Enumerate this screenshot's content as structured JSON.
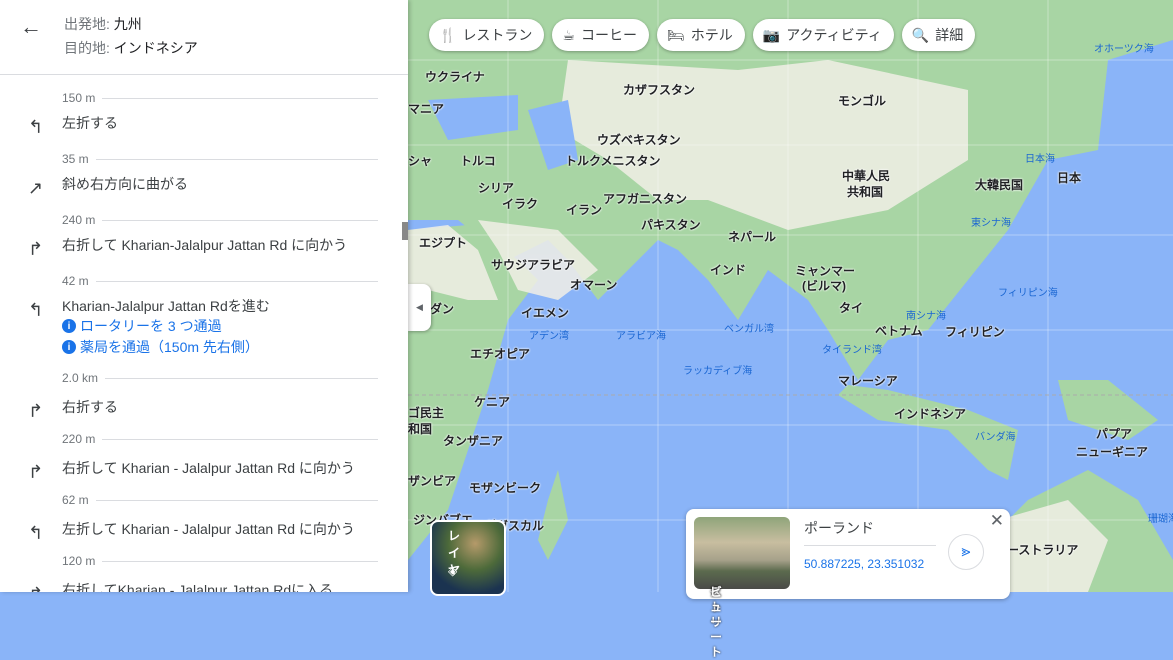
{
  "header": {
    "origin_label": "出発地: ",
    "origin": "九州",
    "dest_label": "目的地: ",
    "dest": "インドネシア"
  },
  "steps": [
    {
      "distance": "150 m",
      "instruction": "左折する",
      "icon": "turn-left-icon"
    },
    {
      "distance": "35 m",
      "instruction": "斜め右方向に曲がる",
      "icon": "slight-right-icon"
    },
    {
      "distance": "240 m",
      "instruction": "右折して Kharian-Jalalpur Jattan Rd に向かう",
      "icon": "turn-right-icon"
    },
    {
      "distance": "42 m",
      "instruction": "Kharian-Jalalpur Jattan Rdを進む",
      "icon": "turn-left-icon",
      "notes": [
        "ロータリーを 3 つ通過",
        "薬局を通過（150m 先右側）"
      ]
    },
    {
      "distance": "2.0 km",
      "instruction": "右折する",
      "icon": "turn-right-icon"
    },
    {
      "distance": "220 m",
      "instruction": "右折して Kharian - Jalalpur Jattan Rd に向かう",
      "icon": "turn-right-icon"
    },
    {
      "distance": "62 m",
      "instruction": "左折して Kharian - Jalalpur Jattan Rd に向かう",
      "icon": "turn-left-icon"
    },
    {
      "distance": "120 m",
      "instruction": "右折してKharian - Jalalpur Jattan Rdに入る",
      "icon": "turn-right-icon"
    }
  ],
  "chips": [
    {
      "label": "レストラン",
      "icon": "restaurant-icon"
    },
    {
      "label": "コーヒー",
      "icon": "coffee-icon"
    },
    {
      "label": "ホテル",
      "icon": "hotel-icon"
    },
    {
      "label": "アクティビティ",
      "icon": "camera-icon"
    },
    {
      "label": "詳細",
      "icon": "search-icon"
    }
  ],
  "map": {
    "countries": [
      "ウクライナ",
      "マニア",
      "カザフスタン",
      "モンゴル",
      "ウズベキスタン",
      "トルクメニスタン",
      "トルコ",
      "シャ",
      "シリア",
      "イラク",
      "イラン",
      "アフガニスタン",
      "パキスタン",
      "中華人民",
      "共和国",
      "大韓民国",
      "日本",
      "エジプト",
      "サウジアラビア",
      "オマーン",
      "ネパール",
      "インド",
      "ミャンマー",
      "(ビルマ)",
      "タイ",
      "ベトナム",
      "フィリピン",
      "ーダン",
      "イエメン",
      "エチオピア",
      "ケニア",
      "マレーシア",
      "インドネシア",
      "タンザニア",
      "パプア",
      "ニューギニア",
      "モザンビーク",
      "ザンビア",
      "ジンバブエ",
      "マダガスカル",
      "ーストラリア",
      "ゴ民主",
      "和国"
    ],
    "seas": [
      "オホーツク海",
      "日本海",
      "東シナ海",
      "フィリピン海",
      "南シナ海",
      "ベンガル湾",
      "アラビア海",
      "アデン湾",
      "タイランド湾",
      "ラッカディブ海",
      "バンダ海",
      "珊瑚海"
    ]
  },
  "layers": {
    "label": "レイヤ"
  },
  "card": {
    "title": "ポーランド",
    "coords": "50.887225, 23.351032",
    "streetview": "ストリート\nビュー",
    "streetview_1": "ストリート",
    "streetview_2": "ビュー"
  }
}
